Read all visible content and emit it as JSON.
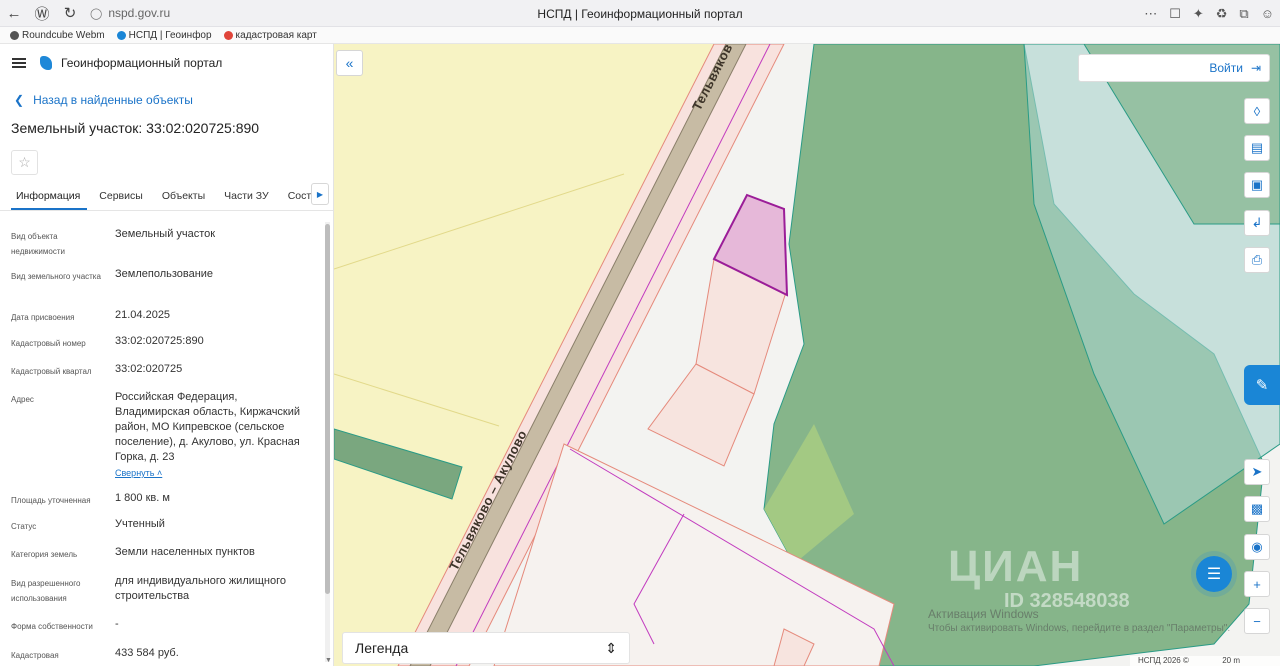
{
  "browser": {
    "url": "nspd.gov.ru",
    "tab_title": "НСПД | Геоинформационный портал",
    "bookmarks": [
      {
        "label": "Roundcube Webm",
        "color": "#555555"
      },
      {
        "label": "НСПД | Геоинфор",
        "color": "#1a86d6"
      },
      {
        "label": "кадастровая карт",
        "color": "#e0453a"
      }
    ]
  },
  "app": {
    "title": "Геоинформационный портал"
  },
  "panel": {
    "back_label": "Назад в найденные объекты",
    "object_title": "Земельный участок: 33:02:020725:890",
    "tabs": [
      "Информация",
      "Сервисы",
      "Объекты",
      "Части ЗУ",
      "Состав"
    ],
    "properties": [
      {
        "key": "Вид объекта недвижимости",
        "value": "Земельный участок"
      },
      {
        "key": "Вид земельного участка",
        "value": "Землепользование"
      },
      {
        "key": "Дата присвоения",
        "value": "21.04.2025"
      },
      {
        "key": "Кадастровый номер",
        "value": "33:02:020725:890"
      },
      {
        "key": "Кадастровый квартал",
        "value": "33:02:020725"
      },
      {
        "key": "Адрес",
        "value": "Российская Федерация, Владимирская область, Киржачский район, МО Кипревское (сельское поселение), д. Акулово, ул. Красная Горка, д. 23"
      },
      {
        "key": "Площадь уточненная",
        "value": "1 800 кв. м"
      },
      {
        "key": "Статус",
        "value": "Учтенный"
      },
      {
        "key": "Категория земель",
        "value": "Земли населенных пунктов"
      },
      {
        "key": "Вид разрешенного использования",
        "value": "для индивидуального жилищного строительства"
      },
      {
        "key": "Форма собственности",
        "value": "-"
      },
      {
        "key": "Кадастровая",
        "value": "433 584 руб."
      }
    ],
    "collapse_label": "Свернуть"
  },
  "map": {
    "login_label": "Войти",
    "legend_label": "Легенда",
    "road_label_1": "Тельвяково – Акулово",
    "road_label_2": "Тельвяков",
    "watermark": "ЦИАН",
    "watermark_id": "ID 328548038",
    "activation_line1": "Активация Windows",
    "activation_line2": "Чтобы активировать Windows, перейдите в раздел \"Параметры\".",
    "attribution": "НСПД 2026 ©",
    "scale": "20 m"
  }
}
